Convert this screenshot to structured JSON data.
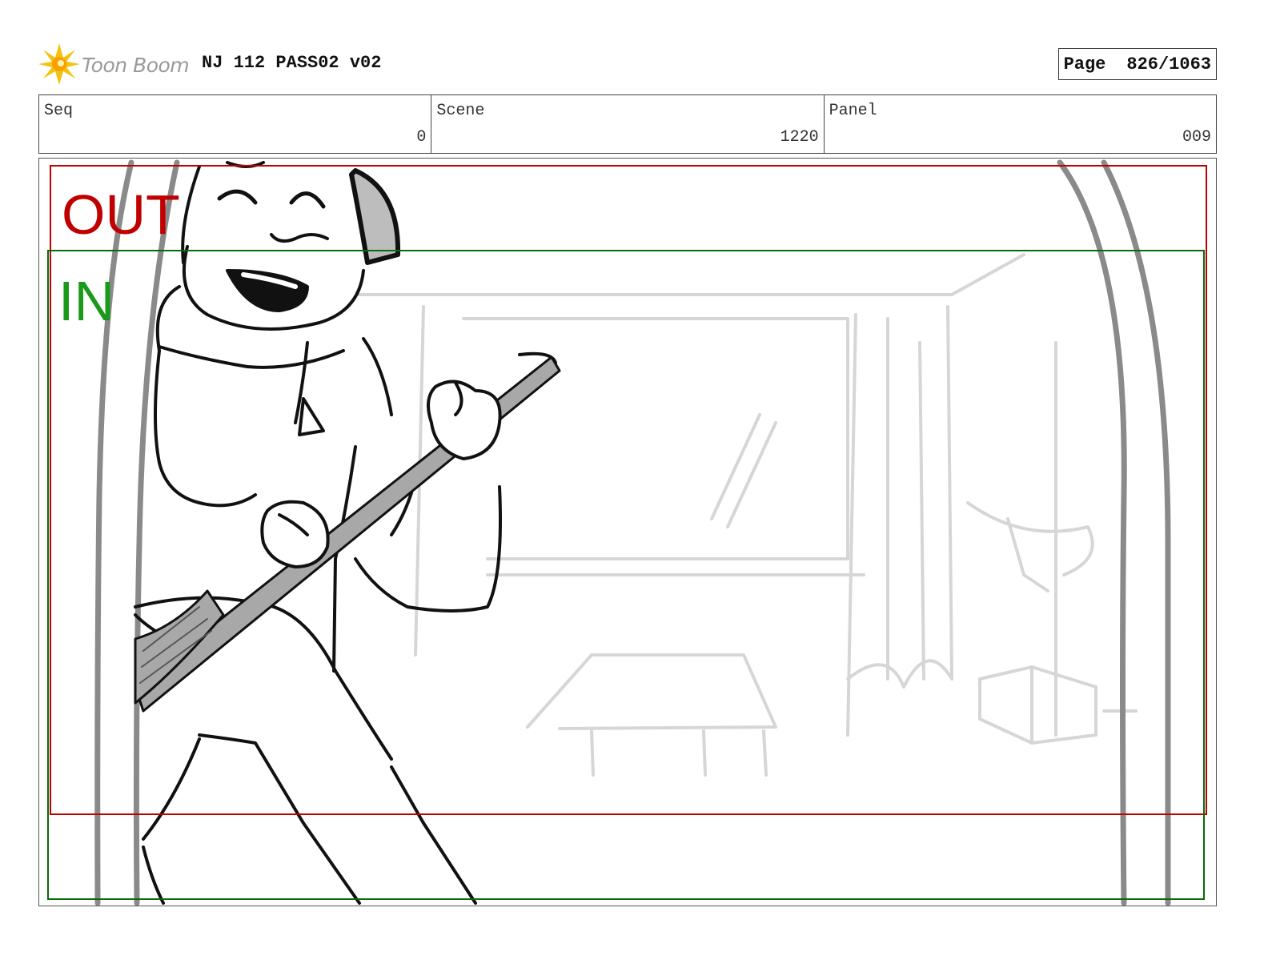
{
  "header": {
    "logo_text": "Toon Boom",
    "title": "NJ 112 PASS02 v02",
    "page_label": "Page",
    "page_number": "826/1063"
  },
  "info": {
    "seq_label": "Seq",
    "seq_value": "0",
    "scene_label": "Scene",
    "scene_value": "1220",
    "panel_label": "Panel",
    "panel_value": "009"
  },
  "frame": {
    "out_label": "OUT",
    "in_label": "IN",
    "out_color": "#c00000",
    "in_color": "#1a9a1a",
    "in_frame_color": "#0a6a0a"
  },
  "drawing": {
    "description_icons": [
      "character-with-headphones",
      "broom",
      "background-room-sketch",
      "curtain-poles"
    ]
  }
}
